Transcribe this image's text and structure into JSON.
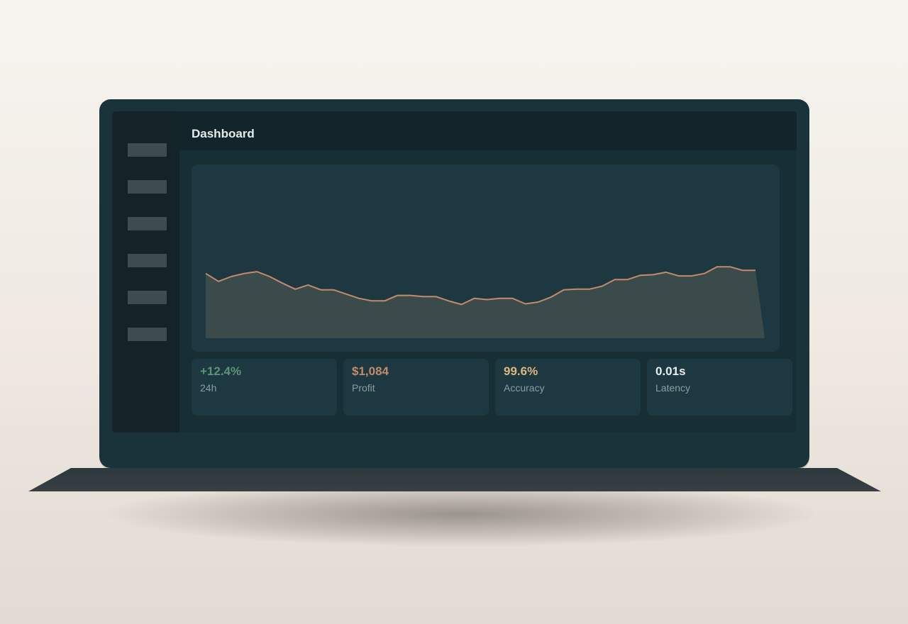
{
  "header": {
    "title": "Dashboard"
  },
  "sidebar": {
    "item_count": 6
  },
  "chart_data": {
    "type": "area",
    "title": "",
    "xlabel": "",
    "ylabel": "",
    "x": [
      0,
      1,
      2,
      3,
      4,
      5,
      6,
      7,
      8,
      9,
      10,
      11,
      12,
      13,
      14,
      15,
      16,
      17,
      18,
      19,
      20,
      21,
      22,
      23,
      24,
      25,
      26,
      27,
      28,
      29,
      30,
      31,
      32,
      33,
      34,
      35,
      36,
      37,
      38,
      39,
      40,
      41,
      42,
      43
    ],
    "values": [
      36.0,
      27.4,
      32.7,
      36.0,
      38.0,
      32.7,
      25.4,
      18.8,
      23.4,
      18.1,
      18.1,
      13.4,
      8.7,
      6.0,
      6.0,
      12.0,
      12.0,
      10.7,
      10.7,
      6.0,
      2.0,
      8.7,
      7.4,
      8.7,
      8.7,
      2.7,
      4.7,
      10.0,
      18.1,
      18.8,
      18.8,
      22.1,
      29.4,
      29.4,
      34.1,
      34.7,
      37.4,
      33.4,
      33.4,
      36.0,
      43.4,
      43.4,
      39.4,
      39.4
    ],
    "ylim": [
      -35,
      140
    ],
    "grid": false,
    "legend": "none",
    "line_color": "#c48b6a",
    "fill_color": "#3b4a4b"
  },
  "stats": [
    {
      "value": "+12.4%",
      "label": "24h",
      "color": "#5c9477"
    },
    {
      "value": "$1,084",
      "label": "Profit",
      "color": "#c48b6a"
    },
    {
      "value": "99.6%",
      "label": "Accuracy",
      "color": "#dcb77f"
    },
    {
      "value": "0.01s",
      "label": "Latency",
      "color": "#e8eef0"
    }
  ]
}
